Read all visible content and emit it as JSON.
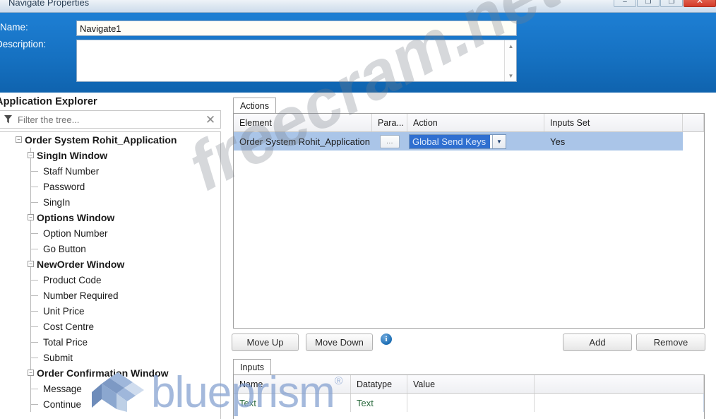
{
  "window": {
    "title": "Navigate Properties",
    "controls": [
      {
        "name": "minimize",
        "glyph": "–"
      },
      {
        "name": "maximize",
        "glyph": "❐"
      },
      {
        "name": "restore",
        "glyph": "❐"
      },
      {
        "name": "close",
        "glyph": "✕"
      }
    ]
  },
  "properties": {
    "name_label": "Name:",
    "name_value": "Navigate1",
    "description_label": "Description:",
    "description_value": "",
    "description_placeholder": ""
  },
  "explorer": {
    "title": "Application Explorer",
    "filter_placeholder": "Filter the tree...",
    "filter_value": "",
    "clear_glyph": "✕",
    "filter_icon": "funnel-icon",
    "tree": [
      {
        "level": 0,
        "label": "Order System Rohit_Application",
        "expanded": true
      },
      {
        "level": 1,
        "label": "SingIn Window",
        "expanded": true
      },
      {
        "level": 2,
        "label": "Staff Number"
      },
      {
        "level": 2,
        "label": "Password"
      },
      {
        "level": 2,
        "label": "SingIn"
      },
      {
        "level": 1,
        "label": "Options Window",
        "expanded": true
      },
      {
        "level": 2,
        "label": "Option Number"
      },
      {
        "level": 2,
        "label": "Go Button"
      },
      {
        "level": 1,
        "label": "NewOrder Window",
        "expanded": true
      },
      {
        "level": 2,
        "label": "Product Code"
      },
      {
        "level": 2,
        "label": "Number Required"
      },
      {
        "level": 2,
        "label": "Unit Price"
      },
      {
        "level": 2,
        "label": "Cost Centre"
      },
      {
        "level": 2,
        "label": "Total Price"
      },
      {
        "level": 2,
        "label": "Submit"
      },
      {
        "level": 1,
        "label": "Order Confirmation Window",
        "expanded": true
      },
      {
        "level": 2,
        "label": "Message"
      },
      {
        "level": 2,
        "label": "Continue"
      }
    ]
  },
  "actions": {
    "tab_label": "Actions",
    "columns": [
      "Element",
      "Para...",
      "Action",
      "Inputs Set"
    ],
    "rows": [
      {
        "element": "Order System Rohit_Application",
        "param_button": "...",
        "action": "Global Send Keys",
        "inputs_set": "Yes",
        "selected": true
      }
    ]
  },
  "toolbar": {
    "move_up_label": "Move Up",
    "move_down_label": "Move Down",
    "add_label": "Add",
    "remove_label": "Remove",
    "info_glyph": "i"
  },
  "inputs": {
    "tab_label": "Inputs",
    "columns": [
      "Name",
      "Datatype",
      "Value"
    ],
    "rows": [
      {
        "name": "Text",
        "datatype": "Text",
        "value": ""
      }
    ]
  },
  "watermarks": {
    "primary": "freecram.net",
    "brand_text": "blueprism",
    "brand_reg": "®"
  },
  "colors": {
    "header_blue": "#1570c0",
    "selection_blue": "#aac5e8",
    "combo_blue": "#2f6fd0",
    "close_red": "#d43b28"
  }
}
